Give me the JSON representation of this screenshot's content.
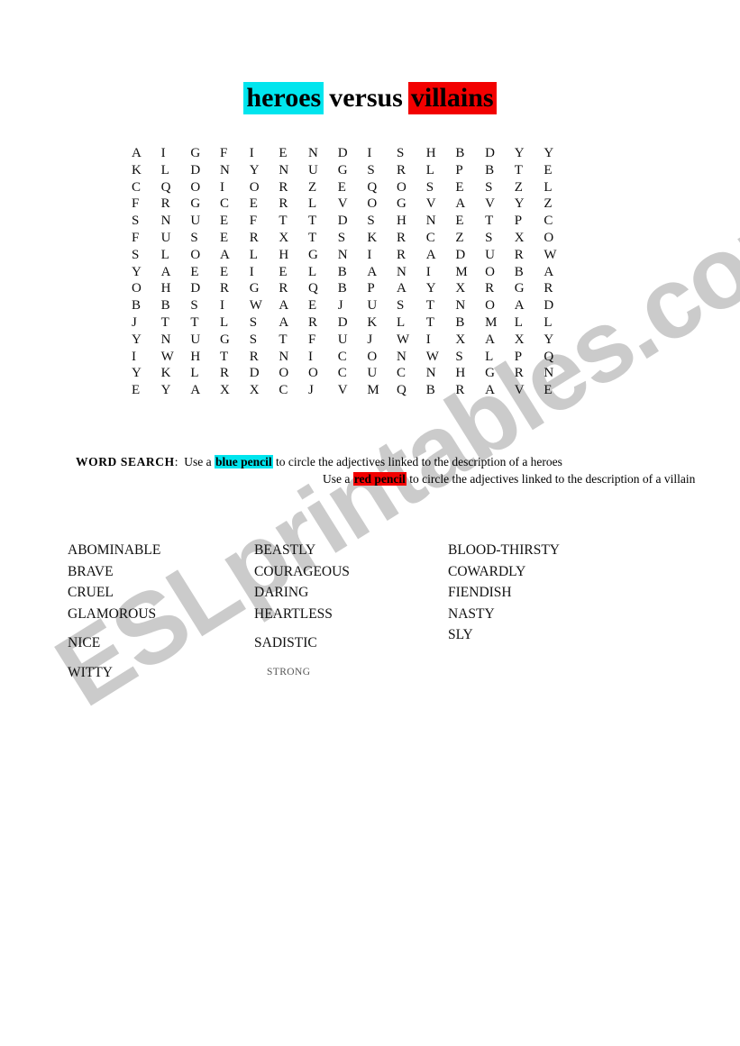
{
  "document": {
    "title_parts": [
      {
        "text": "heroes",
        "style": "highlight-cyan"
      },
      {
        "text": "versus",
        "style": "plain"
      },
      {
        "text": "villains",
        "style": "highlight-red"
      }
    ],
    "title_plain": "heroes versus villains"
  },
  "colors": {
    "highlight_cyan": "#00e5ee",
    "highlight_red": "#f20000",
    "text": "#000000",
    "watermark": "#c9c9c9",
    "page_background": "#ffffff"
  },
  "puzzle": {
    "rows": 15,
    "cols": 15,
    "grid": [
      [
        "A",
        "I",
        "G",
        "F",
        "I",
        "E",
        "N",
        "D",
        "I",
        "S",
        "H",
        "B",
        "D",
        "Y",
        "Y"
      ],
      [
        "K",
        "L",
        "D",
        "N",
        "Y",
        "N",
        "U",
        "G",
        "S",
        "R",
        "L",
        "P",
        "B",
        "T",
        "E"
      ],
      [
        "C",
        "Q",
        "O",
        "I",
        "O",
        "R",
        "Z",
        "E",
        "Q",
        "O",
        "S",
        "E",
        "S",
        "Z",
        "L"
      ],
      [
        "F",
        "R",
        "G",
        "C",
        "E",
        "R",
        "L",
        "V",
        "O",
        "G",
        "V",
        "A",
        "V",
        "Y",
        "Z"
      ],
      [
        "S",
        "N",
        "U",
        "E",
        "F",
        "T",
        "T",
        "D",
        "S",
        "H",
        "N",
        "E",
        "T",
        "P",
        "C"
      ],
      [
        "F",
        "U",
        "S",
        "E",
        "R",
        "X",
        "T",
        "S",
        "K",
        "R",
        "C",
        "Z",
        "S",
        "X",
        "O"
      ],
      [
        "S",
        "L",
        "O",
        "A",
        "L",
        "H",
        "G",
        "N",
        "I",
        "R",
        "A",
        "D",
        "U",
        "R",
        "W"
      ],
      [
        "Y",
        "A",
        "E",
        "E",
        "I",
        "E",
        "L",
        "B",
        "A",
        "N",
        "I",
        "M",
        "O",
        "B",
        "A"
      ],
      [
        "O",
        "H",
        "D",
        "R",
        "G",
        "R",
        "Q",
        "B",
        "P",
        "A",
        "Y",
        "X",
        "R",
        "G",
        "R"
      ],
      [
        "B",
        "B",
        "S",
        "I",
        "W",
        "A",
        "E",
        "J",
        "U",
        "S",
        "T",
        "N",
        "O",
        "A",
        "D"
      ],
      [
        "J",
        "T",
        "T",
        "L",
        "S",
        "A",
        "R",
        "D",
        "K",
        "L",
        "T",
        "B",
        "M",
        "L",
        "L"
      ],
      [
        "Y",
        "N",
        "U",
        "G",
        "S",
        "T",
        "F",
        "U",
        "J",
        "W",
        "I",
        "X",
        "A",
        "X",
        "Y"
      ],
      [
        "I",
        "W",
        "H",
        "T",
        "R",
        "N",
        "I",
        "C",
        "O",
        "N",
        "W",
        "S",
        "L",
        "P",
        "Q"
      ],
      [
        "Y",
        "K",
        "L",
        "R",
        "D",
        "O",
        "O",
        "C",
        "U",
        "C",
        "N",
        "H",
        "G",
        "R",
        "N"
      ],
      [
        "E",
        "Y",
        "A",
        "X",
        "X",
        "C",
        "J",
        "V",
        "M",
        "Q",
        "B",
        "R",
        "A",
        "V",
        "E"
      ]
    ]
  },
  "instructions": {
    "label": "WORD  SEARCH",
    "colon": ":",
    "line1_pre": "Use a",
    "line1_highlight": "blue pencil",
    "line1_post": "to circle the adjectives linked to the description  of a heroes",
    "line2_pre": "Use a",
    "line2_highlight": "red pencil",
    "line2_post": "to circle the adjectives linked to the description  of a villain"
  },
  "wordlist": {
    "column1": [
      {
        "word": "ABOMINABLE",
        "size": "normal",
        "gap_before": false
      },
      {
        "word": "BRAVE",
        "size": "normal",
        "gap_before": false
      },
      {
        "word": "CRUEL",
        "size": "normal",
        "gap_before": false
      },
      {
        "word": "GLAMOROUS",
        "size": "normal",
        "gap_before": false
      },
      {
        "word": "NICE",
        "size": "normal",
        "gap_before": true
      },
      {
        "word": "WITTY",
        "size": "normal",
        "gap_before": true
      }
    ],
    "column2": [
      {
        "word": "BEASTLY",
        "size": "normal",
        "gap_before": false
      },
      {
        "word": "COURAGEOUS",
        "size": "normal",
        "gap_before": false
      },
      {
        "word": "DARING",
        "size": "normal",
        "gap_before": false
      },
      {
        "word": "HEARTLESS",
        "size": "normal",
        "gap_before": false
      },
      {
        "word": "SADISTIC",
        "size": "normal",
        "gap_before": true
      },
      {
        "word": "STRONG",
        "size": "small",
        "gap_before": true
      }
    ],
    "column3": [
      {
        "word": "BLOOD-THIRSTY",
        "size": "normal",
        "gap_before": false
      },
      {
        "word": "COWARDLY",
        "size": "normal",
        "gap_before": false
      },
      {
        "word": "FIENDISH",
        "size": "normal",
        "gap_before": false
      },
      {
        "word": "NASTY",
        "size": "normal",
        "gap_before": false
      },
      {
        "word": "SLY",
        "size": "normal",
        "gap_before": false
      }
    ]
  },
  "watermark": {
    "text": "ESLprintables.com"
  }
}
